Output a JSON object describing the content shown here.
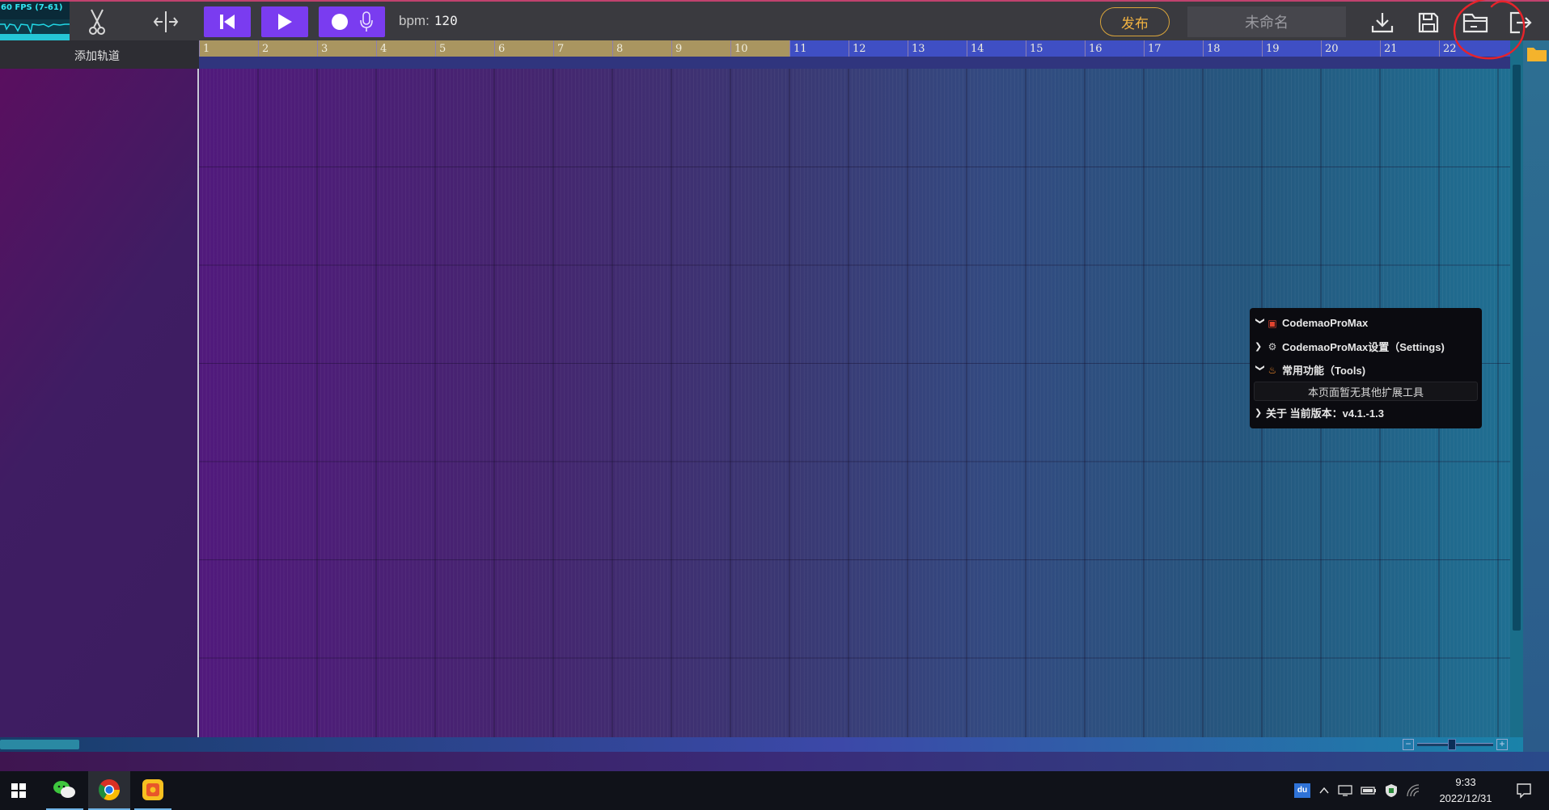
{
  "fps": {
    "label": "60 FPS (7-61)"
  },
  "toolbar": {
    "bpm_label": "bpm:",
    "bpm_value": "120",
    "publish_label": "发布",
    "project_name": "未命名"
  },
  "track_header": {
    "add_track_label": "添加轨道"
  },
  "ruler": {
    "bars": [
      "1",
      "2",
      "3",
      "4",
      "5",
      "6",
      "7",
      "8",
      "9",
      "10",
      "11",
      "12",
      "13",
      "14",
      "15",
      "16",
      "17",
      "18",
      "19",
      "20",
      "21",
      "22"
    ],
    "played_bars": 10
  },
  "promax": {
    "title": "CodemaoProMax",
    "settings_label": "CodemaoProMax设置（Settings)",
    "tools_label": "常用功能（Tools)",
    "empty_message": "本页面暂无其他扩展工具",
    "about_label": "关于 当前版本：v4.1.-1.3"
  },
  "zoom": {
    "minus": "−",
    "plus": "+",
    "level": 0.45
  },
  "taskbar": {
    "tray_du": "du",
    "time": "9:33",
    "date": "2022/12/31"
  },
  "colors": {
    "accent_purple": "#7a3cf0",
    "publish_gold": "#f2b341",
    "annotation_red": "#e8232a"
  }
}
